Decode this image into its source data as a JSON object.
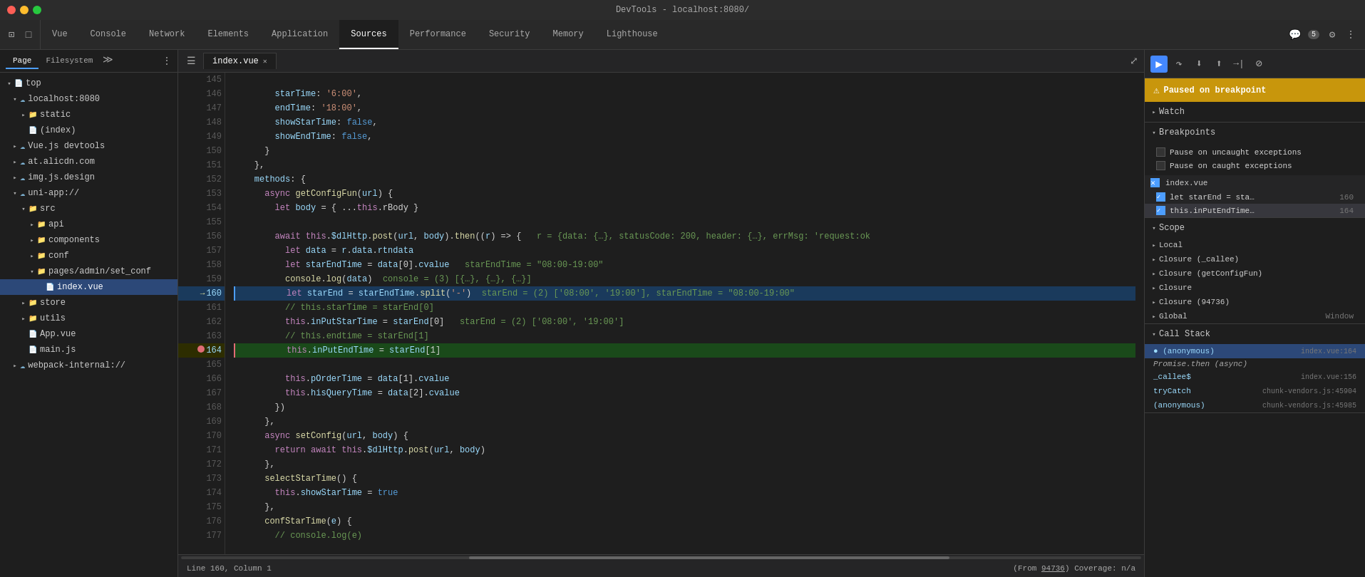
{
  "title_bar": {
    "title": "DevTools - localhost:8080/"
  },
  "nav": {
    "tabs": [
      {
        "id": "vue",
        "label": "Vue"
      },
      {
        "id": "console",
        "label": "Console"
      },
      {
        "id": "network",
        "label": "Network"
      },
      {
        "id": "elements",
        "label": "Elements"
      },
      {
        "id": "application",
        "label": "Application"
      },
      {
        "id": "sources",
        "label": "Sources",
        "active": true
      },
      {
        "id": "performance",
        "label": "Performance"
      },
      {
        "id": "security",
        "label": "Security"
      },
      {
        "id": "memory",
        "label": "Memory"
      },
      {
        "id": "lighthouse",
        "label": "Lighthouse"
      }
    ],
    "badge": "5"
  },
  "file_panel": {
    "tabs": [
      {
        "label": "Page",
        "active": true
      },
      {
        "label": "Filesystem"
      }
    ],
    "tree": [
      {
        "id": "top",
        "label": "top",
        "indent": 0,
        "type": "folder",
        "open": true,
        "icon": "page"
      },
      {
        "id": "localhost",
        "label": "localhost:8080",
        "indent": 1,
        "type": "cloud",
        "open": true
      },
      {
        "id": "static",
        "label": "static",
        "indent": 2,
        "type": "folder",
        "open": false
      },
      {
        "id": "index",
        "label": "(index)",
        "indent": 2,
        "type": "file"
      },
      {
        "id": "vuedevtools",
        "label": "Vue.js devtools",
        "indent": 1,
        "type": "cloud",
        "open": false
      },
      {
        "id": "alicdn",
        "label": "at.alicdn.com",
        "indent": 1,
        "type": "cloud",
        "open": false
      },
      {
        "id": "imgjs",
        "label": "img.js.design",
        "indent": 1,
        "type": "cloud",
        "open": false
      },
      {
        "id": "uniapp",
        "label": "uni-app://",
        "indent": 1,
        "type": "cloud",
        "open": true
      },
      {
        "id": "src",
        "label": "src",
        "indent": 2,
        "type": "folder",
        "open": true
      },
      {
        "id": "api",
        "label": "api",
        "indent": 3,
        "type": "folder",
        "open": false
      },
      {
        "id": "components",
        "label": "components",
        "indent": 3,
        "type": "folder",
        "open": false
      },
      {
        "id": "conf",
        "label": "conf",
        "indent": 3,
        "type": "folder",
        "open": false
      },
      {
        "id": "pagesadmin",
        "label": "pages/admin/set_conf",
        "indent": 3,
        "type": "folder",
        "open": true
      },
      {
        "id": "indexvue",
        "label": "index.vue",
        "indent": 4,
        "type": "file",
        "selected": true
      },
      {
        "id": "store",
        "label": "store",
        "indent": 2,
        "type": "folder",
        "open": false
      },
      {
        "id": "utils",
        "label": "utils",
        "indent": 2,
        "type": "folder",
        "open": false
      },
      {
        "id": "appvue",
        "label": "App.vue",
        "indent": 2,
        "type": "file"
      },
      {
        "id": "mainjs",
        "label": "main.js",
        "indent": 2,
        "type": "file"
      },
      {
        "id": "webpack",
        "label": "webpack-internal://",
        "indent": 1,
        "type": "cloud",
        "open": false
      }
    ]
  },
  "code_panel": {
    "file_tab": "index.vue",
    "lines": [
      {
        "num": 145,
        "content": ""
      },
      {
        "num": 146,
        "content": "        starTime: '6:00',"
      },
      {
        "num": 147,
        "content": "        endTime: '18:00',"
      },
      {
        "num": 148,
        "content": "        showStarTime: false,"
      },
      {
        "num": 149,
        "content": "        showEndTime: false,"
      },
      {
        "num": 150,
        "content": "      }"
      },
      {
        "num": 151,
        "content": "    },"
      },
      {
        "num": 152,
        "content": "    methods: {"
      },
      {
        "num": 153,
        "content": "      async getConfigFun(url) {"
      },
      {
        "num": 154,
        "content": "        let body = { ...this.rBody }"
      },
      {
        "num": 155,
        "content": ""
      },
      {
        "num": 156,
        "content": "        await this.$dlHttp.post(url, body).then((r) => {   r = {data: {…}, statusCode: 200, header: {…}, errMsg: 'request:ok"
      },
      {
        "num": 157,
        "content": "          let data = r.data.rtndata"
      },
      {
        "num": 158,
        "content": "          let starEndTime = data[0].cvalue   starEndTime = \"08:00-19:00\""
      },
      {
        "num": 159,
        "content": "          console.log(data)  console = (3) [{…}, {…}, {…}]"
      },
      {
        "num": 160,
        "content": "          let starEnd = starEndTime.split('-')  starEnd = (2) ['08:00', '19:00'], starEndTime = \"08:00-19:00\"",
        "current": true
      },
      {
        "num": 161,
        "content": "          // this.starTime = starEnd[0]"
      },
      {
        "num": 162,
        "content": "          this.inPutStarTime = starEnd[0]   starEnd = (2) ['08:00', '19:00']"
      },
      {
        "num": 163,
        "content": "          // this.endtime = starEnd[1]"
      },
      {
        "num": 164,
        "content": "          this.inPutEndTime = starEnd[1]",
        "breakpoint": true,
        "current_bp": true
      },
      {
        "num": 165,
        "content": ""
      },
      {
        "num": 166,
        "content": "          this.pOrderTime = data[1].cvalue"
      },
      {
        "num": 167,
        "content": "          this.hisQueryTime = data[2].cvalue"
      },
      {
        "num": 168,
        "content": "        })"
      },
      {
        "num": 169,
        "content": "      },"
      },
      {
        "num": 170,
        "content": "      async setConfig(url, body) {"
      },
      {
        "num": 171,
        "content": "        return await this.$dlHttp.post(url, body)"
      },
      {
        "num": 172,
        "content": "      },"
      },
      {
        "num": 173,
        "content": "      selectStarTime() {"
      },
      {
        "num": 174,
        "content": "        this.showStarTime = true"
      },
      {
        "num": 175,
        "content": "      },"
      },
      {
        "num": 176,
        "content": "      confStarTime(e) {"
      },
      {
        "num": 177,
        "content": "        // console.log(e)"
      }
    ],
    "status": "Line 160, Column 1",
    "coverage": "(From 94736)  Coverage: n/a"
  },
  "right_panel": {
    "toolbar_buttons": [
      {
        "id": "resume",
        "label": "▶",
        "tooltip": "Resume script execution",
        "active": true
      },
      {
        "id": "step-over",
        "label": "↷",
        "tooltip": "Step over"
      },
      {
        "id": "step-into",
        "label": "↓",
        "tooltip": "Step into"
      },
      {
        "id": "step-out",
        "label": "↑",
        "tooltip": "Step out"
      },
      {
        "id": "step",
        "label": "→|",
        "tooltip": "Step"
      },
      {
        "id": "deactivate",
        "label": "⊘",
        "tooltip": "Deactivate breakpoints"
      }
    ],
    "paused_message": "Paused on breakpoint",
    "sections": {
      "watch": {
        "label": "Watch",
        "expanded": false
      },
      "breakpoints": {
        "label": "Breakpoints",
        "expanded": true,
        "items": [
          {
            "checked": false,
            "text": "Pause on uncaught exceptions"
          },
          {
            "checked": false,
            "text": "Pause on caught exceptions"
          }
        ],
        "files": [
          {
            "name": "index.vue",
            "items": [
              {
                "checked": true,
                "text": "let starEnd = sta…",
                "line": 160
              },
              {
                "checked": true,
                "text": "this.inPutEndTime…",
                "line": 164,
                "selected": true
              }
            ]
          }
        ]
      },
      "scope": {
        "label": "Scope",
        "expanded": true,
        "groups": [
          {
            "label": "Local",
            "expanded": false
          },
          {
            "label": "Closure (_callee)",
            "expanded": false
          },
          {
            "label": "Closure (getConfigFun)",
            "expanded": false
          },
          {
            "label": "Closure",
            "expanded": false
          },
          {
            "label": "Closure (94736)",
            "expanded": false
          },
          {
            "label": "Global",
            "extra": "Window",
            "expanded": false
          }
        ]
      },
      "call_stack": {
        "label": "Call Stack",
        "expanded": true,
        "items": [
          {
            "name": "(anonymous)",
            "location": "index.vue:164",
            "selected": true
          },
          {
            "async": true,
            "label": "Promise.then (async)"
          },
          {
            "name": "_callee$",
            "location": "index.vue:156"
          },
          {
            "name": "tryCatch",
            "location": "chunk-vendors.js:45904"
          },
          {
            "name": "(anonymous)",
            "location": "chunk-vendors.js:45985"
          }
        ]
      }
    }
  }
}
